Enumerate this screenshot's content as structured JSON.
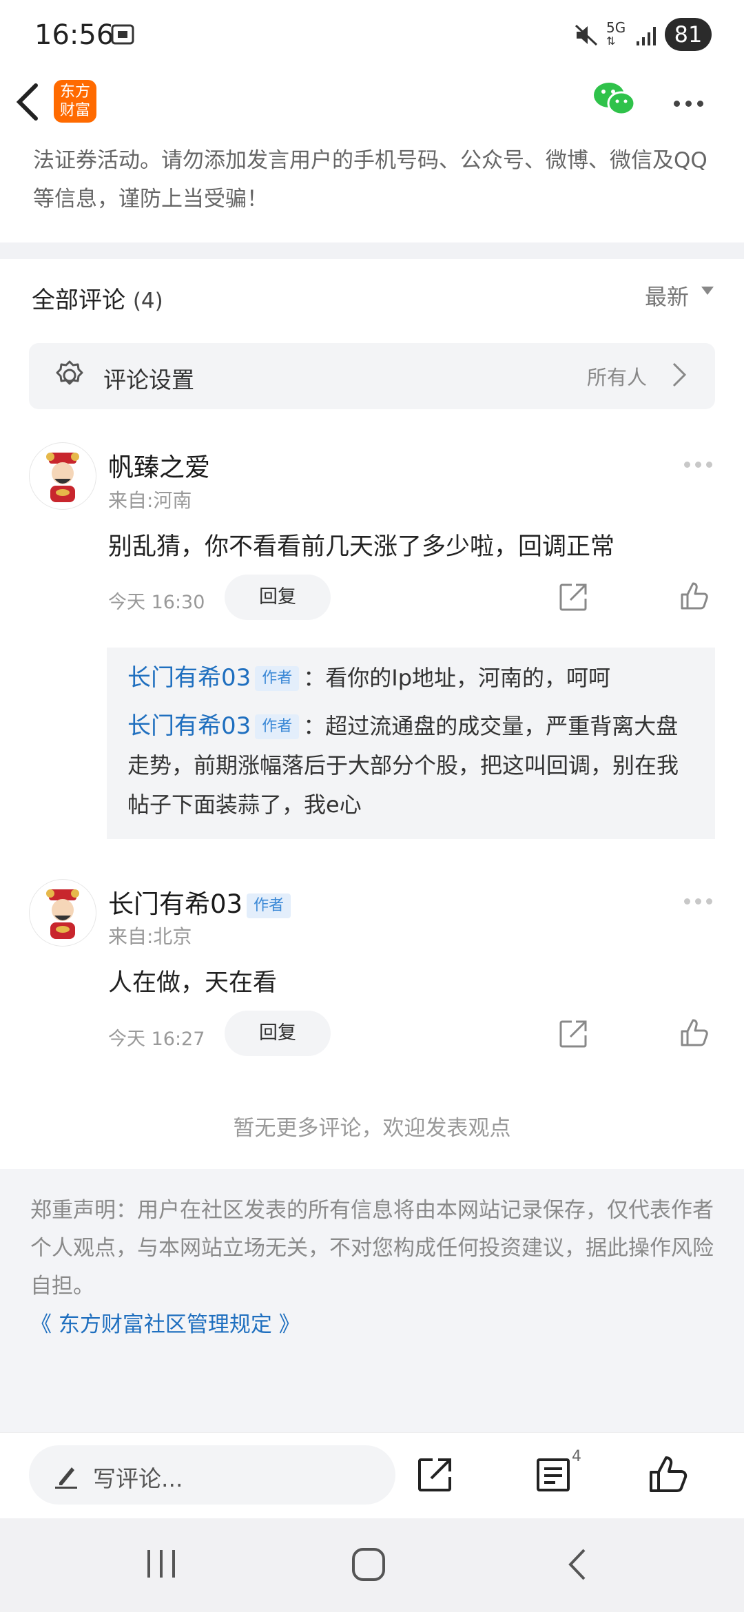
{
  "status_bar": {
    "time": "16:56",
    "network": "5G",
    "battery": "81"
  },
  "header": {
    "logo_text_line1": "东方",
    "logo_text_line2": "财富",
    "brand_color": "#ff6a00"
  },
  "notice": {
    "text": "法证券活动。请勿添加发言用户的手机号码、公众号、微博、微信及QQ等信息，谨防上当受骗！"
  },
  "comments_section": {
    "title": "全部评论",
    "count": "(4)",
    "sort_label": "最新",
    "settings_label": "评论设置",
    "settings_value": "所有人"
  },
  "comments": [
    {
      "username": "帆臻之爱",
      "location": "来自:河南",
      "text": "别乱猜，你不看看前几天涨了多少啦，回调正常",
      "time": "今天 16:30",
      "reply_label": "回复",
      "replies": [
        {
          "author": "长门有希03",
          "tag": "作者",
          "text": "：看你的Ip地址，河南的，呵呵"
        },
        {
          "author": "长门有希03",
          "tag": "作者",
          "text": "：超过流通盘的成交量，严重背离大盘走势，前期涨幅落后于大部分个股，把这叫回调，别在我帖子下面装蒜了，我e心"
        }
      ]
    },
    {
      "username": "长门有希03",
      "tag": "作者",
      "location": "来自:北京",
      "text": "人在做，天在看",
      "time": "今天 16:27",
      "reply_label": "回复"
    }
  ],
  "no_more_text": "暂无更多评论，欢迎发表观点",
  "disclaimer": {
    "text": "郑重声明：用户在社区发表的所有信息将由本网站记录保存，仅代表作者个人观点，与本网站立场无关，不对您构成任何投资建议，据此操作风险自担。",
    "link": "《 东方财富社区管理规定 》"
  },
  "bottom_bar": {
    "input_placeholder": "写评论...",
    "comment_count": "4"
  },
  "colors": {
    "accent_link": "#1f6fbf",
    "wechat_green": "#2fc24a"
  }
}
